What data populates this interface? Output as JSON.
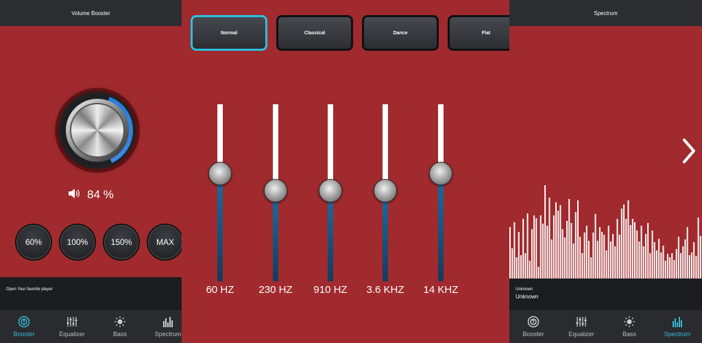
{
  "left": {
    "title": "Volume Booster",
    "volume_percent": "84 %",
    "knob_level": 0.84,
    "presets": [
      "60%",
      "100%",
      "150%",
      "MAX"
    ],
    "player_text": "Open Your favorite player",
    "nav": [
      {
        "label": "Booster",
        "icon": "booster-icon",
        "active": true
      },
      {
        "label": "Equalizer",
        "icon": "equalizer-icon",
        "active": false
      },
      {
        "label": "Bass",
        "icon": "bass-icon",
        "active": false
      },
      {
        "label": "Spectrum",
        "icon": "spectrum-icon",
        "active": false
      }
    ]
  },
  "middle": {
    "presets": [
      {
        "label": "Normal",
        "active": true
      },
      {
        "label": "Classical",
        "active": false
      },
      {
        "label": "Dance",
        "active": false
      },
      {
        "label": "Flat",
        "active": false
      }
    ],
    "bands": [
      {
        "label": "60 HZ",
        "level": 0.61
      },
      {
        "label": "230 HZ",
        "level": 0.51
      },
      {
        "label": "910 HZ",
        "level": 0.51
      },
      {
        "label": "3.6 KHZ",
        "level": 0.51
      },
      {
        "label": "14 KHZ",
        "level": 0.61
      }
    ]
  },
  "right": {
    "title": "Spectrum",
    "player_line1": "Unknown",
    "player_line2": "Unknown",
    "nav": [
      {
        "label": "Booster",
        "icon": "booster-icon",
        "active": false
      },
      {
        "label": "Equalizer",
        "icon": "equalizer-icon",
        "active": false
      },
      {
        "label": "Bass",
        "icon": "bass-icon",
        "active": false
      },
      {
        "label": "Spectrum",
        "icon": "spectrum-icon",
        "active": true
      }
    ],
    "spectrum_levels": [
      0.53,
      0.31,
      0.58,
      0.22,
      0.48,
      0.24,
      0.61,
      0.26,
      0.67,
      0.18,
      0.51,
      0.65,
      0.62,
      0.12,
      0.65,
      0.56,
      0.96,
      0.54,
      0.83,
      0.4,
      0.65,
      0.78,
      0.7,
      0.75,
      0.51,
      0.42,
      0.59,
      0.82,
      0.57,
      0.36,
      0.68,
      0.8,
      0.43,
      0.26,
      0.47,
      0.54,
      0.39,
      0.22,
      0.47,
      0.66,
      0.39,
      0.53,
      0.48,
      0.45,
      0.29,
      0.54,
      0.38,
      0.46,
      0.33,
      0.61,
      0.45,
      0.72,
      0.76,
      0.61,
      0.8,
      0.55,
      0.61,
      0.58,
      0.49,
      0.38,
      0.54,
      0.33,
      0.46,
      0.57,
      0.26,
      0.49,
      0.37,
      0.29,
      0.41,
      0.27,
      0.34,
      0.18,
      0.25,
      0.22,
      0.26,
      0.19,
      0.3,
      0.43,
      0.26,
      0.33,
      0.4,
      0.53,
      0.24,
      0.27,
      0.37,
      0.23,
      0.63,
      0.44
    ]
  },
  "colors": {
    "background": "#a02a2d",
    "bar_dark": "#2b2d31",
    "accent": "#37b8d6",
    "knob_arc": "#2a7bd6"
  }
}
